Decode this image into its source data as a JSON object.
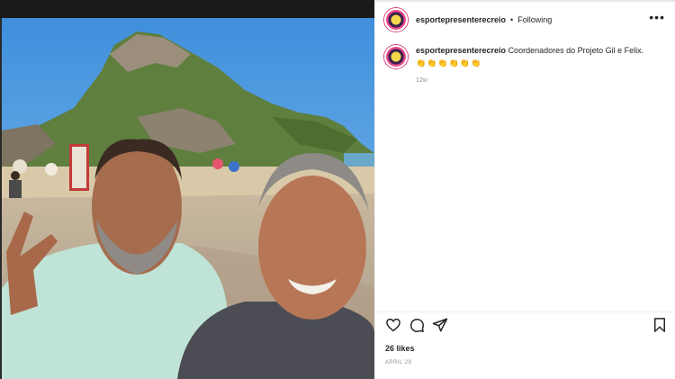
{
  "post": {
    "username": "esportepresenterecreio",
    "separator": "•",
    "follow_status": "Following",
    "more_label": "•••",
    "caption": {
      "username": "esportepresenterecreio",
      "text": "Coordenadores do Projeto Gil e Felix.",
      "emojis": "👏👏👏👏👏👏",
      "age": "12w"
    },
    "likes": "26 likes",
    "date": "APRIL 28"
  },
  "icons": {
    "like": "heart-icon",
    "comment": "comment-icon",
    "share": "send-icon",
    "save": "bookmark-icon"
  },
  "colors": {
    "text": "#262626",
    "muted": "#8e8e8e",
    "divider": "#efefef",
    "avatar_ring": "#d43b7a"
  }
}
